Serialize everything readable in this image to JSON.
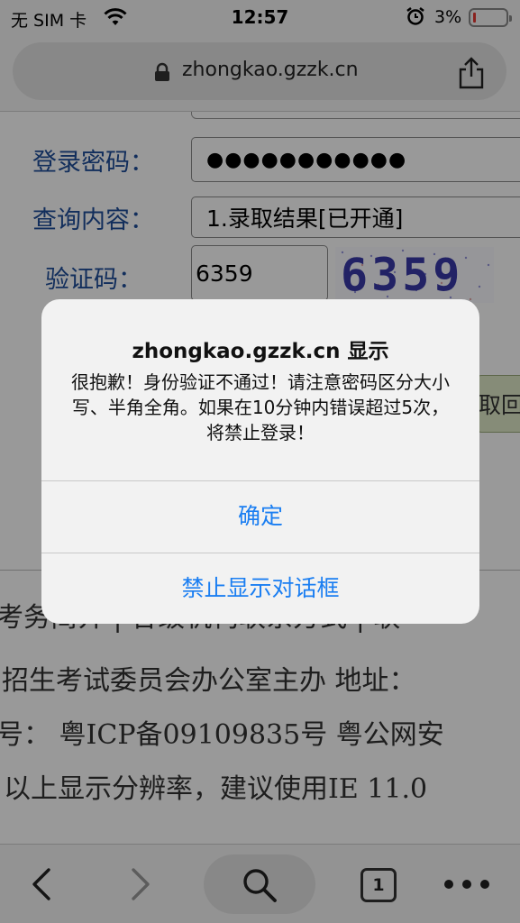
{
  "status_bar": {
    "carrier": "无 SIM 卡",
    "time": "12:57",
    "battery_percent": "3%",
    "battery_level": 0.03,
    "icons": [
      "wifi-icon",
      "alarm-icon",
      "battery-icon"
    ]
  },
  "browser": {
    "url": "zhongkao.gzzk.cn",
    "icons": [
      "lock-icon",
      "share-icon"
    ]
  },
  "form": {
    "password_label": "登录密码：",
    "password_value": "●●●●●●●●●●●",
    "query_label": "查询内容：",
    "query_value": "1.录取结果[已开通]",
    "captcha_label": "验证码：",
    "captcha_value": "6359",
    "captcha_image_text": "6359",
    "side_button_label": "取回密"
  },
  "footer": {
    "line1": "考务简介 | 各级机构联系方式 | 联",
    "line2": "招生考试委员会办公室主办 地址：",
    "line3": "号： 粤ICP备09109835号  粤公网安",
    "line4": "以上显示分辨率，建议使用IE 11.0"
  },
  "alert": {
    "title": "zhongkao.gzzk.cn 显示",
    "message": "很抱歉！身份验证不通过！请注意密码区分大小写、半角全角。如果在10分钟内错误超过5次，将禁止登录！",
    "confirm_label": "确定",
    "block_label": "禁止显示对话框"
  },
  "toolbar": {
    "tab_count": "1",
    "icons": [
      "back-icon",
      "forward-icon",
      "search-icon",
      "tabs-icon",
      "more-icon"
    ]
  },
  "colors": {
    "form_label": "#1f4e9a",
    "alert_button": "#1a7ef2",
    "overlay": "rgba(0,0,0,0.40)"
  }
}
